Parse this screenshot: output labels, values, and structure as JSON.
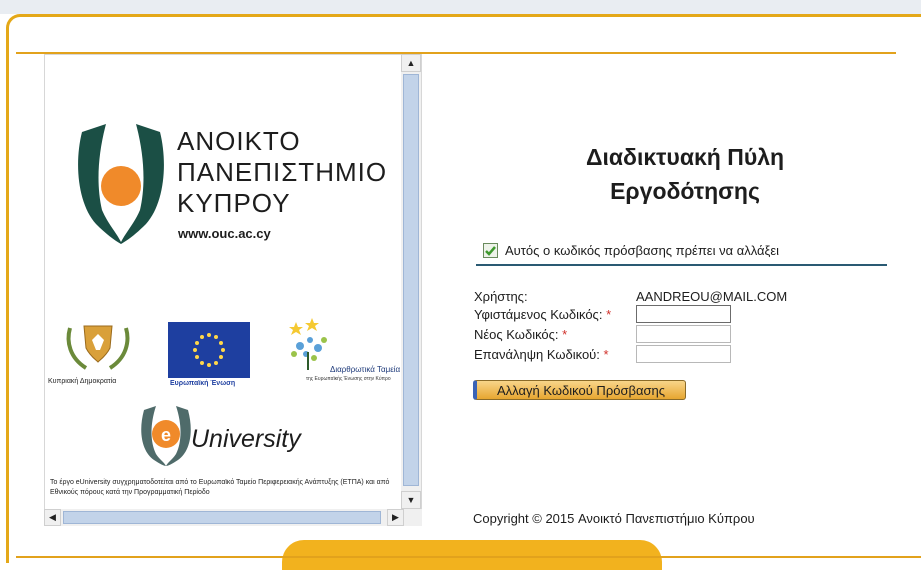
{
  "header": {
    "title_line1": "Διαδικτυακή Πύλη",
    "title_line2": "Εργοδότησης"
  },
  "left_panel": {
    "university_name": [
      "ΑΝΟΙΚΤΟ",
      "ΠΑΝΕΠΙΣΤΗΜΙΟ",
      "ΚΥΠΡΟΥ"
    ],
    "university_url": "www.ouc.ac.cy",
    "partner_logos": [
      {
        "label": "Κυπριακή Δημοκρατία",
        "icon": "cyprus-crest-icon"
      },
      {
        "label": "Ευρωπαϊκή Ένωση",
        "icon": "eu-flag-icon"
      },
      {
        "label": "Διαρθρωτικά Ταμεία",
        "sublabel": "της Ευρωπαϊκής Ένωσης στην Κύπρο",
        "icon": "structural-funds-icon"
      }
    ],
    "euniversity_prefix": "e",
    "euniversity_label": "University",
    "footnote": "Το έργο eUniversity συγχρηματοδοτείται από το Ευρωπαϊκό Ταμείο Περιφερειακής Ανάπτυξης (ΕΤΠΑ) και από Εθνικούς πόρους κατά την Προγραμματική Περίοδο"
  },
  "notice": {
    "text": "Αυτός ο κωδικός πρόσβασης πρέπει να αλλάξει",
    "checked": true
  },
  "form": {
    "user_label": "Χρήστης:",
    "user_value": "AANDREOU@MAIL.COM",
    "current_password_label": "Υφιστάμενος Κωδικός:",
    "new_password_label": "Νέος Κωδικός:",
    "repeat_password_label": "Επανάληψη Κωδικού:",
    "required_marker": "*",
    "current_password_value": "",
    "new_password_value": "",
    "repeat_password_value": ""
  },
  "actions": {
    "change_password_label": "Αλλαγή Κωδικού Πρόσβασης"
  },
  "footer": {
    "copyright": "Copyright © 2015 Ανοικτό Πανεπιστήμιο Κύπρου"
  },
  "colors": {
    "accent_gold": "#e4a818",
    "divider_blue": "#2a5a73",
    "required_red": "#d0302a",
    "ouc_green": "#1b4f45",
    "ouc_orange": "#f08a2a"
  }
}
